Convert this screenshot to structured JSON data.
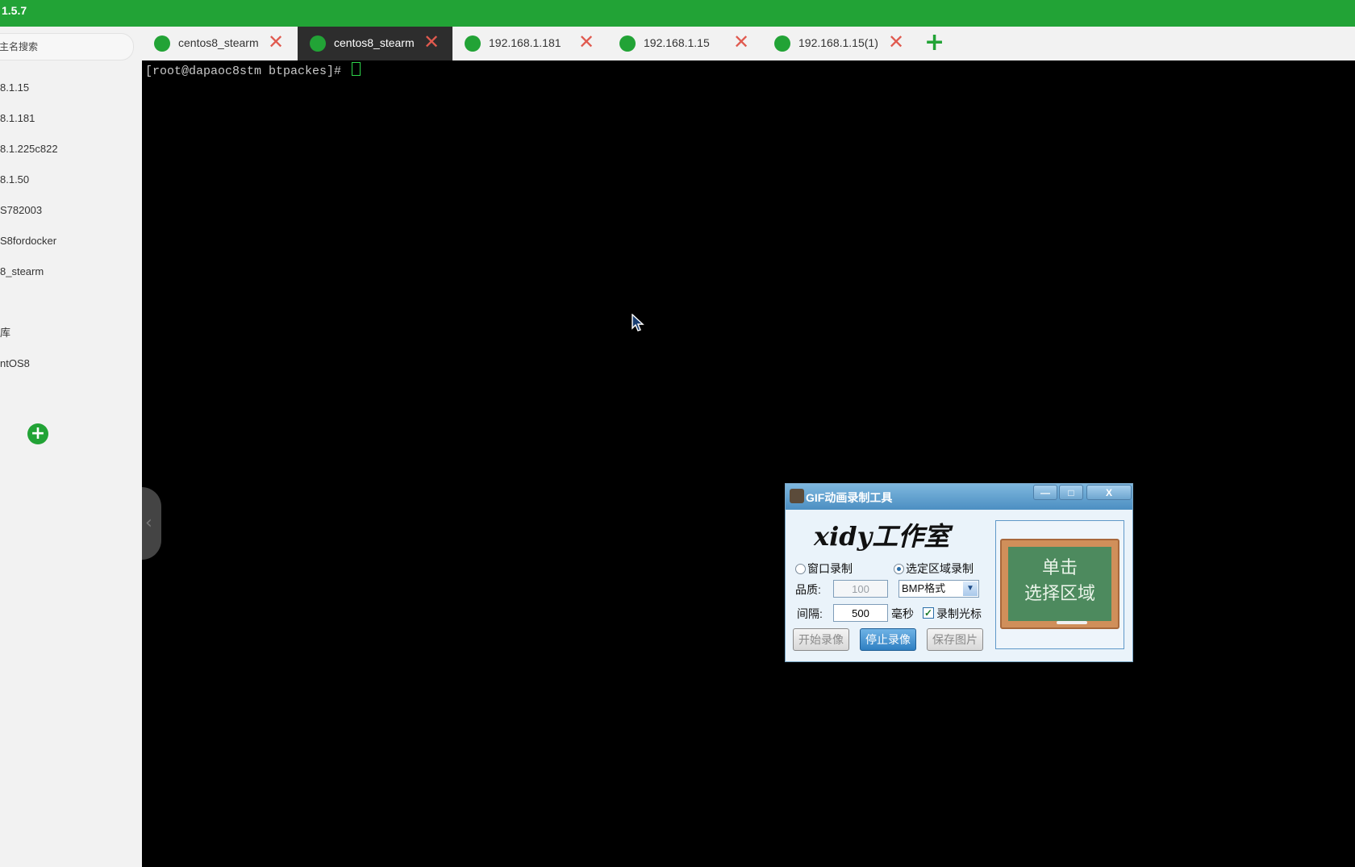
{
  "app": {
    "version_title": "1.5.7"
  },
  "sidebar": {
    "search_placeholder": "主名搜索",
    "items": [
      {
        "label": "8.1.15"
      },
      {
        "label": "8.1.181"
      },
      {
        "label": "8.1.225c822"
      },
      {
        "label": "8.1.50"
      },
      {
        "label": "S782003"
      },
      {
        "label": "S8fordocker"
      },
      {
        "label": "8_stearm"
      },
      {
        "label": "库"
      },
      {
        "label": "ntOS8"
      }
    ],
    "add_icon": "plus-circle-icon",
    "collapse_icon": "chevron-left-icon"
  },
  "tabs": [
    {
      "label": "centos8_stearm",
      "active": false
    },
    {
      "label": "centos8_stearm",
      "active": true
    },
    {
      "label": "192.168.1.181",
      "active": false
    },
    {
      "label": "192.168.1.15",
      "active": false
    },
    {
      "label": "192.168.1.15(1)",
      "active": false
    }
  ],
  "terminal": {
    "prompt": "[root@dapaoc8stm btpackes]# "
  },
  "gif_tool": {
    "title": "GIF动画录制工具",
    "brand": "xidy工作室",
    "window_buttons": {
      "minimize": "—",
      "maximize": "□",
      "close": "X"
    },
    "radio_window": "窗口录制",
    "radio_region": "选定区域录制",
    "quality_label": "品质:",
    "quality_value": "100",
    "format_value": "BMP格式",
    "interval_label": "间隔:",
    "interval_value": "500",
    "interval_unit": "毫秒",
    "record_cursor_label": "录制光标",
    "start_button": "开始录像",
    "stop_button": "停止录像",
    "save_button": "保存图片",
    "preview_line1": "单击",
    "preview_line2": "选择区域"
  },
  "colors": {
    "brand_green": "#22a336",
    "close_red": "#e05a4f",
    "terminal_bg": "#000000"
  }
}
